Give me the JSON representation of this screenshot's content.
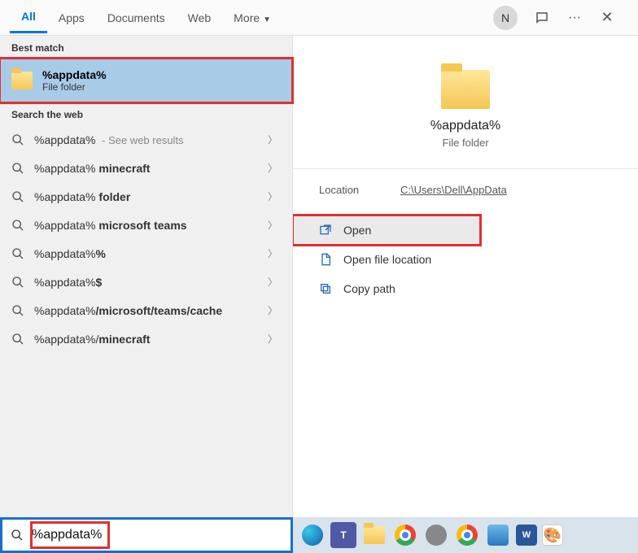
{
  "tabs": {
    "items": [
      "All",
      "Apps",
      "Documents",
      "Web",
      "More"
    ],
    "active": 0
  },
  "header": {
    "avatar_initial": "N",
    "more_dots": "···"
  },
  "left": {
    "best_match_label": "Best match",
    "best_match": {
      "title": "%appdata%",
      "subtitle": "File folder"
    },
    "search_web_label": "Search the web",
    "web_items": [
      {
        "prefix": "%appdata%",
        "bold": "",
        "hint": " - See web results"
      },
      {
        "prefix": "%appdata%",
        "bold": " minecraft",
        "hint": ""
      },
      {
        "prefix": "%appdata%",
        "bold": " folder",
        "hint": ""
      },
      {
        "prefix": "%appdata%",
        "bold": " microsoft teams",
        "hint": ""
      },
      {
        "prefix": "%appdata%",
        "bold": "%",
        "hint": ""
      },
      {
        "prefix": "%appdata%",
        "bold": "$",
        "hint": ""
      },
      {
        "prefix": "%appdata%",
        "bold": "/microsoft/teams/cache",
        "hint": ""
      },
      {
        "prefix": "%appdata%/",
        "bold": "minecraft",
        "hint": ""
      }
    ]
  },
  "preview": {
    "title": "%appdata%",
    "subtitle": "File folder",
    "location_label": "Location",
    "location_value": "C:\\Users\\Dell\\AppData",
    "actions": [
      {
        "label": "Open",
        "selected": true,
        "icon": "open-icon"
      },
      {
        "label": "Open file location",
        "selected": false,
        "icon": "file-location-icon"
      },
      {
        "label": "Copy path",
        "selected": false,
        "icon": "copy-icon"
      }
    ]
  },
  "search": {
    "query": "%appdata%"
  },
  "taskbar": {
    "items": [
      "edge",
      "teams",
      "explorer",
      "chrome",
      "app1",
      "chrome2",
      "snip",
      "word",
      "paint"
    ]
  }
}
